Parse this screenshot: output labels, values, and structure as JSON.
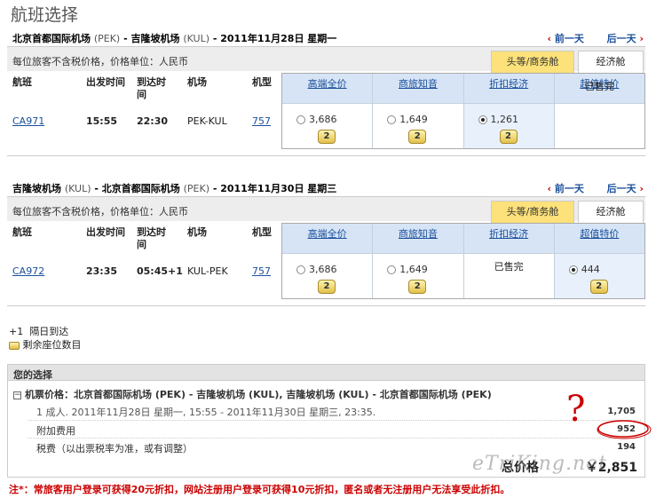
{
  "page_title": "航班选择",
  "nav": {
    "prev_day": "前一天",
    "next_day": "后一天",
    "prev_arrow": "‹",
    "next_arrow": "›"
  },
  "fare_note": "每位旅客不含税价格，价格单位：人民币",
  "tabs": {
    "first_business": "头等/商务舱",
    "economy": "经济舱"
  },
  "columns": {
    "flight": "航班",
    "depart": "出发时间",
    "arrive": "到达时间",
    "airport": "机场",
    "aircraft": "机型",
    "fares": [
      "高端全价",
      "商旅知音",
      "折扣经济",
      "超值特价"
    ]
  },
  "sold_out": "已售完",
  "legs": [
    {
      "route_from": "北京首都国际机场",
      "route_from_code": "(PEK)",
      "dash": " - ",
      "route_to": "吉隆坡机场",
      "route_to_code": "(KUL)",
      "date": " - 2011年11月28日  星期一",
      "flight": "CA971",
      "depart": "15:55",
      "arrive": "22:30",
      "airport": "PEK-KUL",
      "aircraft": "757",
      "fares": [
        {
          "price": "3,686",
          "seats": "2"
        },
        {
          "price": "1,649",
          "seats": "2"
        },
        {
          "price": "1,261",
          "seats": "2",
          "selected": true
        },
        {
          "sold_out": true
        }
      ]
    },
    {
      "route_from": "吉隆坡机场",
      "route_from_code": "(KUL)",
      "dash": " - ",
      "route_to": "北京首都国际机场",
      "route_to_code": "(PEK)",
      "date": " - 2011年11月30日  星期三",
      "flight": "CA972",
      "depart": "23:35",
      "arrive": "05:45+1",
      "airport": "KUL-PEK",
      "aircraft": "757",
      "fares": [
        {
          "price": "3,686",
          "seats": "2"
        },
        {
          "price": "1,649",
          "seats": "2"
        },
        {
          "sold_out": true
        },
        {
          "price": "444",
          "seats": "2",
          "selected": true
        }
      ]
    }
  ],
  "legend": {
    "next_day_mark": "+1",
    "next_day_text": "隔日到达",
    "seats_text": "剩余座位数目"
  },
  "summary": {
    "title": "您的选择",
    "ticket_label": "机票价格：",
    "ticket_route": "北京首都国际机场 (PEK) - 吉隆坡机场 (KUL), 吉隆坡机场 (KUL) - 北京首都国际机场 (PEK)",
    "passenger_line": "1 成人. 2011年11月28日  星期一, 15:55 - 2011年11月30日  星期三, 23:35.",
    "ticket_value": "1,705",
    "surcharge_label": "附加费用",
    "surcharge_value": "952",
    "tax_label": "税费（以出票税率为准，或有调整）",
    "tax_value": "194",
    "total_label": "总价格",
    "total_value": "￥2,851"
  },
  "footnote": "注*：常旅客用户登录可获得20元折扣，网站注册用户登录可获得10元折扣，匿名或者无注册用户无法享受此折扣。",
  "watermark": "eTriKing.net",
  "annotation_mark": "?",
  "colors": {
    "link": "#1a4f9c",
    "fare_header": "#d6e4f5",
    "tab_first": "#fde17a",
    "footnote": "#cc0000",
    "annotation": "#cc0000"
  }
}
